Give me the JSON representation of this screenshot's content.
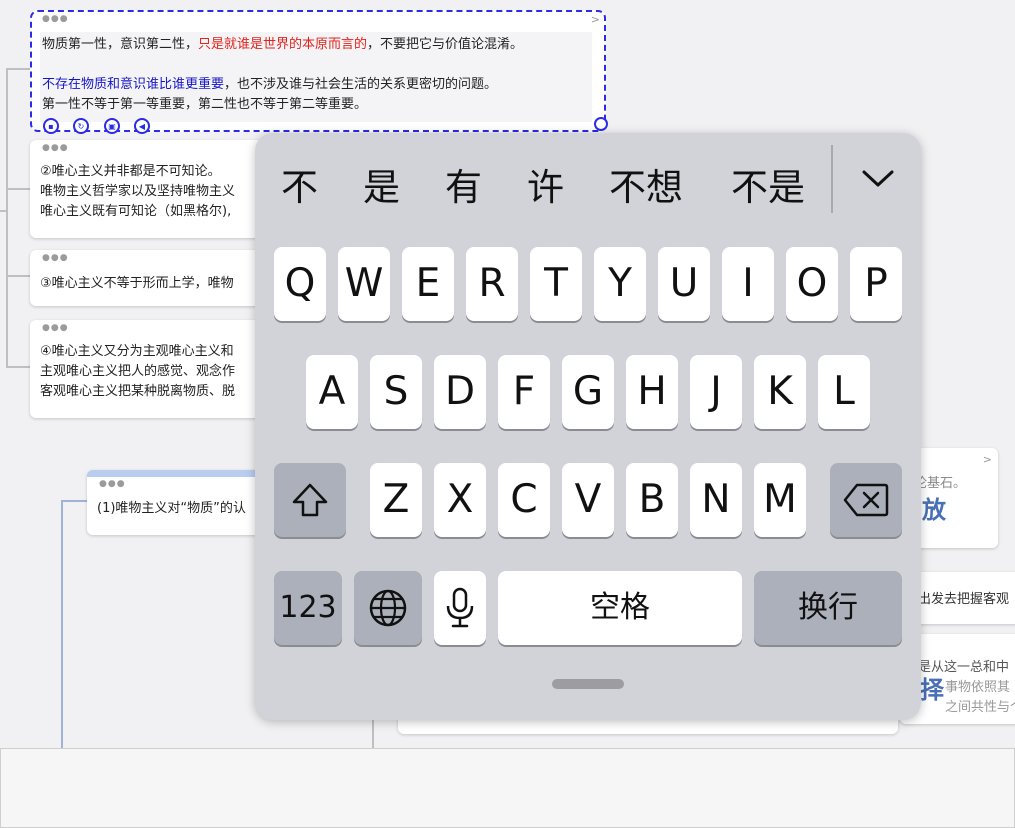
{
  "mindmap": {
    "selected_node": {
      "line1_part1": "物质第一性，意识第二性，",
      "line1_red": "只是就谁是世界的本原而言的",
      "line1_part2": "，不要把它与价值论混淆。",
      "line2_blue": "不存在物质和意识谁比谁更重要",
      "line2_part2": "，也不涉及谁与社会生活的关系更密切的问题。",
      "line3": "第一性不等于第一等重要，第二性也不等于第二等重要。"
    },
    "node2": {
      "line1": "②唯心主义并非都是不可知论。",
      "line2": "唯物主义哲学家以及坚持唯物主义",
      "line3": "唯心主义既有可知论（如黑格尔),"
    },
    "node3": {
      "line1": "③唯心主义不等于形而上学，唯物"
    },
    "node4": {
      "line1": "④唯心主义又分为主观唯心主义和",
      "line2": "主观唯心主义把人的感觉、观念作",
      "line3": "客观唯心主义把某种脱离物质、脱"
    },
    "node5": {
      "line1": "(1)唯物主义对“物质”的认"
    },
    "right_node1": {
      "line1": "论基石。",
      "big": "放"
    },
    "right_node2": {
      "line1": "出发去把握客观"
    },
    "right_node3": {
      "line1": "是从这一总和中",
      "line2": "事物依照其",
      "line3": "之间共性与个",
      "big": "择"
    }
  },
  "keyboard": {
    "candidates": [
      "不",
      "是",
      "有",
      "许",
      "不想",
      "不是"
    ],
    "row1": [
      "Q",
      "W",
      "E",
      "R",
      "T",
      "Y",
      "U",
      "I",
      "O",
      "P"
    ],
    "row2": [
      "A",
      "S",
      "D",
      "F",
      "G",
      "H",
      "J",
      "K",
      "L"
    ],
    "row3": [
      "Z",
      "X",
      "C",
      "V",
      "B",
      "N",
      "M"
    ],
    "numbers_label": "123",
    "space_label": "空格",
    "return_label": "换行"
  }
}
